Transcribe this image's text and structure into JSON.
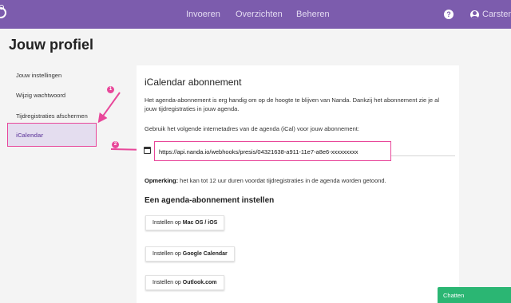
{
  "topbar": {
    "nav": [
      "Invoeren",
      "Overzichten",
      "Beheren"
    ],
    "help_label": "?",
    "user_name": "Carsten"
  },
  "page_title": "Jouw profiel",
  "sidebar": {
    "items": [
      {
        "label": "Jouw instellingen"
      },
      {
        "label": "Wijzig wachtwoord"
      },
      {
        "label": "Tijdregistraties afschermen"
      },
      {
        "label": "iCalendar"
      }
    ]
  },
  "annotations": [
    "1",
    "2"
  ],
  "card": {
    "title": "iCalendar abonnement",
    "intro": "Het agenda-abonnement is erg handig om op de hoogte te blijven van Nanda. Dankzij het abonnement zie je al jouw tijdregistraties in jouw agenda.",
    "lead": "Gebruik het volgende internetadres van de agenda (iCal) voor jouw abonnement:",
    "url": "https://api.nanda.io/webhooks/presis/04321638-a911-11e7-a8e6-xxxxxxxxx",
    "note_label": "Opmerking:",
    "note_text": " het kan tot 12 uur duren voordat tijdregistraties in de agenda worden getoond.",
    "section_title": "Een agenda-abonnement instellen",
    "buttons": [
      {
        "prefix": "Instellen op ",
        "target": "Mac OS / iOS"
      },
      {
        "prefix": "Instellen op ",
        "target": "Google Calendar"
      },
      {
        "prefix": "Instellen op ",
        "target": "Outlook.com"
      }
    ]
  },
  "chat_label": "Chatten",
  "colors": {
    "brand": "#7c5cad",
    "highlight": "#e8479a",
    "chat": "#2bb673"
  }
}
